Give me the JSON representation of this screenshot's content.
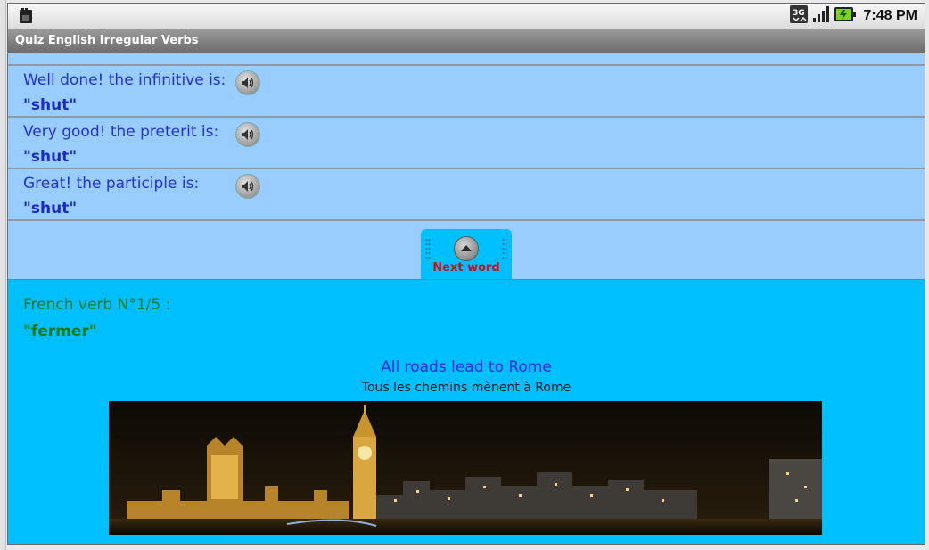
{
  "status_bar": {
    "time": "7:48 PM",
    "network_label": "3G"
  },
  "app": {
    "title": "Quiz English Irregular Verbs"
  },
  "answers": [
    {
      "label": "Well done! the infinitive is:",
      "value": "\"shut\"",
      "icon": "speaker-icon"
    },
    {
      "label": "Very good! the preterit is:",
      "value": "\"shut\"",
      "icon": "speaker-icon"
    },
    {
      "label": "Great! the participle is:",
      "value": "\"shut\"",
      "icon": "speaker-icon"
    }
  ],
  "next_button": {
    "label": "Next word",
    "icon": "up-arrow-icon"
  },
  "french": {
    "label": "French verb N°1/5 :",
    "value": "\"fermer\""
  },
  "proverb": {
    "english": "All roads lead to Rome",
    "french": "Tous les chemins mènent à Rome"
  },
  "colors": {
    "upper_background": "#99ccff",
    "lower_background": "#00bfff",
    "answer_text": "#2233cc",
    "french_text": "#1b7a1b",
    "next_label": "#cc1111"
  }
}
